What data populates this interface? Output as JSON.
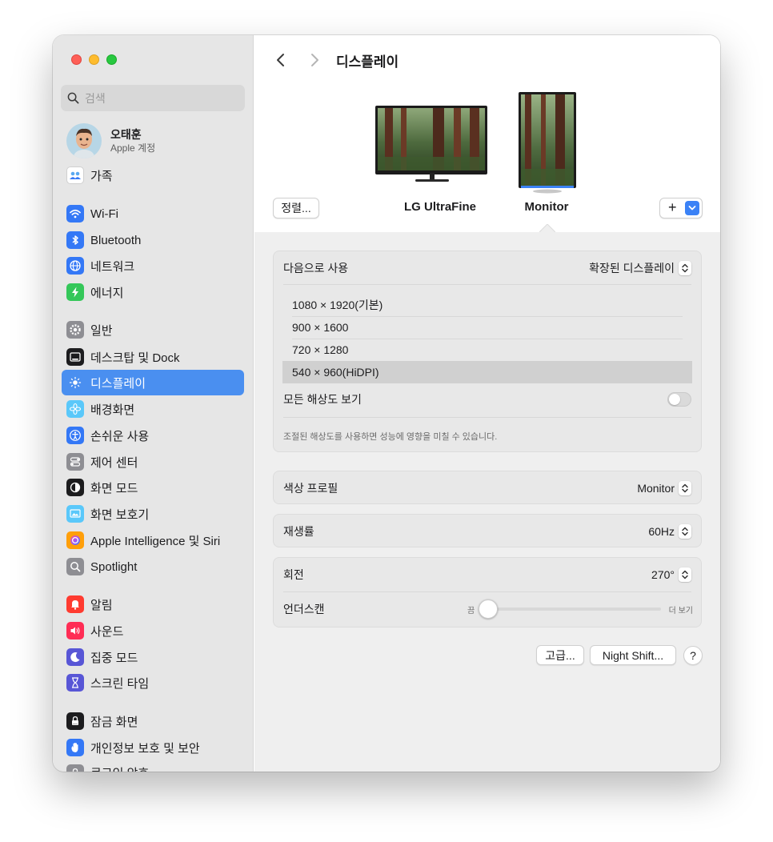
{
  "window": {
    "title": "디스플레이"
  },
  "sidebar": {
    "search_placeholder": "검색",
    "account": {
      "name": "오태훈",
      "subtitle": "Apple 계정"
    },
    "items": [
      {
        "label": "가족",
        "icon": "family-icon",
        "color": "#ffffff"
      },
      {
        "label": "Wi-Fi",
        "icon": "wifi-icon",
        "color": "#3478f6"
      },
      {
        "label": "Bluetooth",
        "icon": "bluetooth-icon",
        "color": "#3478f6"
      },
      {
        "label": "네트워크",
        "icon": "globe-icon",
        "color": "#3478f6"
      },
      {
        "label": "에너지",
        "icon": "bolt-icon",
        "color": "#34c759"
      },
      {
        "label": "일반",
        "icon": "gear-icon",
        "color": "#8e8e93"
      },
      {
        "label": "데스크탑 및 Dock",
        "icon": "dock-icon",
        "color": "#1c1c1e"
      },
      {
        "label": "디스플레이",
        "icon": "sun-icon",
        "color": "#3478f6"
      },
      {
        "label": "배경화면",
        "icon": "flower-icon",
        "color": "#5ac8fa"
      },
      {
        "label": "손쉬운 사용",
        "icon": "accessibility-icon",
        "color": "#3478f6"
      },
      {
        "label": "제어 센터",
        "icon": "toggles-icon",
        "color": "#8e8e93"
      },
      {
        "label": "화면 모드",
        "icon": "appearance-icon",
        "color": "#1c1c1e"
      },
      {
        "label": "화면 보호기",
        "icon": "screensaver-icon",
        "color": "#5ac8fa"
      },
      {
        "label": "Apple Intelligence 및 Siri",
        "icon": "siri-icon",
        "color": "#ff9f0a"
      },
      {
        "label": "Spotlight",
        "icon": "magnifier-icon",
        "color": "#8e8e93"
      },
      {
        "label": "알림",
        "icon": "bell-icon",
        "color": "#ff3b30"
      },
      {
        "label": "사운드",
        "icon": "speaker-icon",
        "color": "#ff2d55"
      },
      {
        "label": "집중 모드",
        "icon": "moon-icon",
        "color": "#5856d6"
      },
      {
        "label": "스크린 타임",
        "icon": "hourglass-icon",
        "color": "#5856d6"
      },
      {
        "label": "잠금 화면",
        "icon": "lock-screen-icon",
        "color": "#1c1c1e"
      },
      {
        "label": "개인정보 보호 및 보안",
        "icon": "hand-icon",
        "color": "#3478f6"
      },
      {
        "label": "로그인 암호",
        "icon": "lock-icon",
        "color": "#8e8e93"
      }
    ],
    "active_index": 7
  },
  "header": {
    "back_icon": "chevron-left-icon",
    "forward_icon": "chevron-right-icon"
  },
  "monitors": {
    "arrange_label": "정렬...",
    "add_label": "+",
    "display1": "LG UltraFine",
    "display2": "Monitor"
  },
  "use_as": {
    "label": "다음으로 사용",
    "value": "확장된 디스플레이"
  },
  "resolutions": {
    "items": [
      "1080 × 1920(기본)",
      "900 × 1600",
      "720 × 1280",
      "540 × 960(HiDPI)"
    ],
    "selected_index": 3,
    "show_all_label": "모든 해상도 보기",
    "show_all_on": false,
    "note": "조절된 해상도를 사용하면 성능에 영향을 미칠 수 있습니다."
  },
  "color_profile": {
    "label": "색상 프로필",
    "value": "Monitor"
  },
  "refresh_rate": {
    "label": "재생률",
    "value": "60Hz"
  },
  "rotation": {
    "label": "회전",
    "value": "270°"
  },
  "underscan": {
    "label": "언더스캔",
    "min_label": "끔",
    "max_label": "더 보기",
    "level": 0
  },
  "buttons": {
    "advanced": "고급...",
    "night_shift": "Night Shift...",
    "help": "?"
  }
}
